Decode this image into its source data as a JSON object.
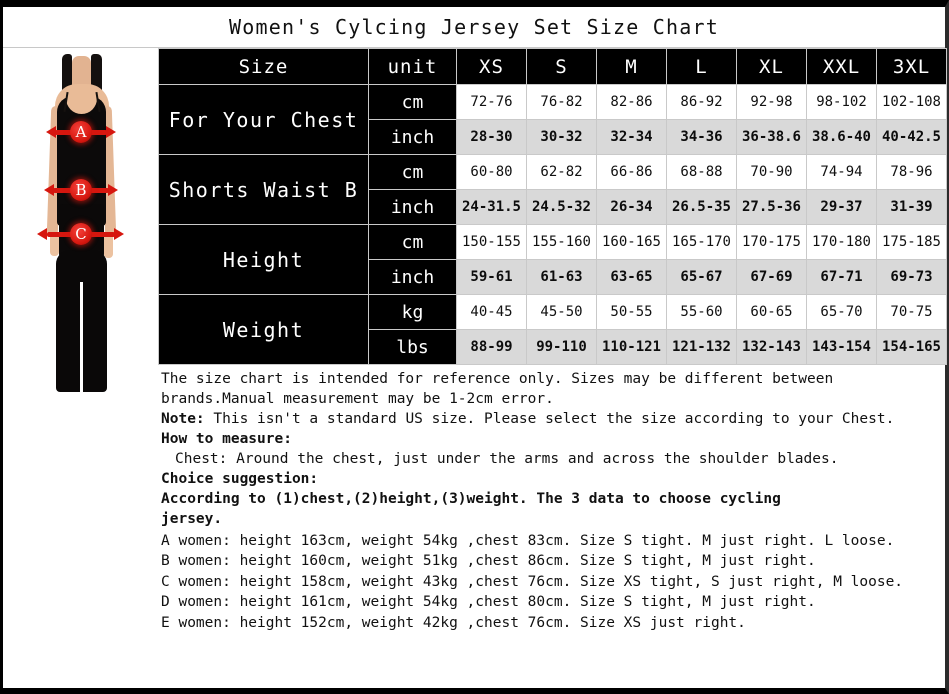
{
  "title": "Women's Cylcing Jersey Set Size Chart",
  "photo": {
    "alt_name": "woman-measurement-photo",
    "markers": [
      {
        "letter": "A",
        "meaning": "chest"
      },
      {
        "letter": "B",
        "meaning": "waist"
      },
      {
        "letter": "C",
        "meaning": "hips"
      }
    ]
  },
  "table": {
    "header": [
      "Size",
      "unit",
      "XS",
      "S",
      "M",
      "L",
      "XL",
      "XXL",
      "3XL"
    ],
    "groups": [
      {
        "label": "For Your Chest",
        "rows": [
          {
            "unit": "cm",
            "values": [
              "72-76",
              "76-82",
              "82-86",
              "86-92",
              "92-98",
              "98-102",
              "102-108"
            ]
          },
          {
            "unit": "inch",
            "values": [
              "28-30",
              "30-32",
              "32-34",
              "34-36",
              "36-38.6",
              "38.6-40",
              "40-42.5"
            ]
          }
        ]
      },
      {
        "label": "Shorts Waist B",
        "rows": [
          {
            "unit": "cm",
            "values": [
              "60-80",
              "62-82",
              "66-86",
              "68-88",
              "70-90",
              "74-94",
              "78-96"
            ]
          },
          {
            "unit": "inch",
            "values": [
              "24-31.5",
              "24.5-32",
              "26-34",
              "26.5-35",
              "27.5-36",
              "29-37",
              "31-39"
            ]
          }
        ]
      },
      {
        "label": "Height",
        "rows": [
          {
            "unit": "cm",
            "values": [
              "150-155",
              "155-160",
              "160-165",
              "165-170",
              "170-175",
              "170-180",
              "175-185"
            ]
          },
          {
            "unit": "inch",
            "values": [
              "59-61",
              "61-63",
              "63-65",
              "65-67",
              "67-69",
              "67-71",
              "69-73"
            ]
          }
        ]
      },
      {
        "label": "Weight",
        "rows": [
          {
            "unit": "kg",
            "values": [
              "40-45",
              "45-50",
              "50-55",
              "55-60",
              "60-65",
              "65-70",
              "70-75"
            ]
          },
          {
            "unit": "lbs",
            "values": [
              "88-99",
              "99-110",
              "110-121",
              "121-132",
              "132-143",
              "143-154",
              "154-165"
            ]
          }
        ]
      }
    ]
  },
  "notes": {
    "disclaimer_line1": "The size chart is intended for reference only. Sizes may be different between",
    "disclaimer_line2": "brands.Manual measurement may be 1-2cm error.",
    "note_label": "Note:",
    "note_text": " This isn't a standard US size. Please select the size according to your Chest.",
    "how_to_measure_label": "How to measure:",
    "how_to_measure_text": "Chest: Around the chest, just under the arms and across the shoulder blades.",
    "choice_label": "Choice suggestion:",
    "choice_line1": "According to (1)chest,(2)height,(3)weight. The 3 data to choose cycling",
    "choice_line2": "jersey.",
    "examples": [
      "A women: height 163cm, weight 54kg ,chest 83cm. Size S tight. M just right. L loose.",
      "B women: height 160cm, weight 51kg ,chest 86cm. Size S tight, M just right.",
      "C women: height 158cm, weight 43kg ,chest 76cm. Size XS tight, S just right, M loose.",
      "D women: height 161cm, weight 54kg ,chest 80cm. Size S tight, M just right.",
      "E women: height 152cm, weight 42kg ,chest 76cm. Size XS just right."
    ]
  },
  "colors": {
    "header_bg": "#000000",
    "header_fg": "#ffffff",
    "row_alt_bg": "#d9d9d9",
    "marker_red": "#d6170f",
    "border": "#c9c9c9"
  }
}
